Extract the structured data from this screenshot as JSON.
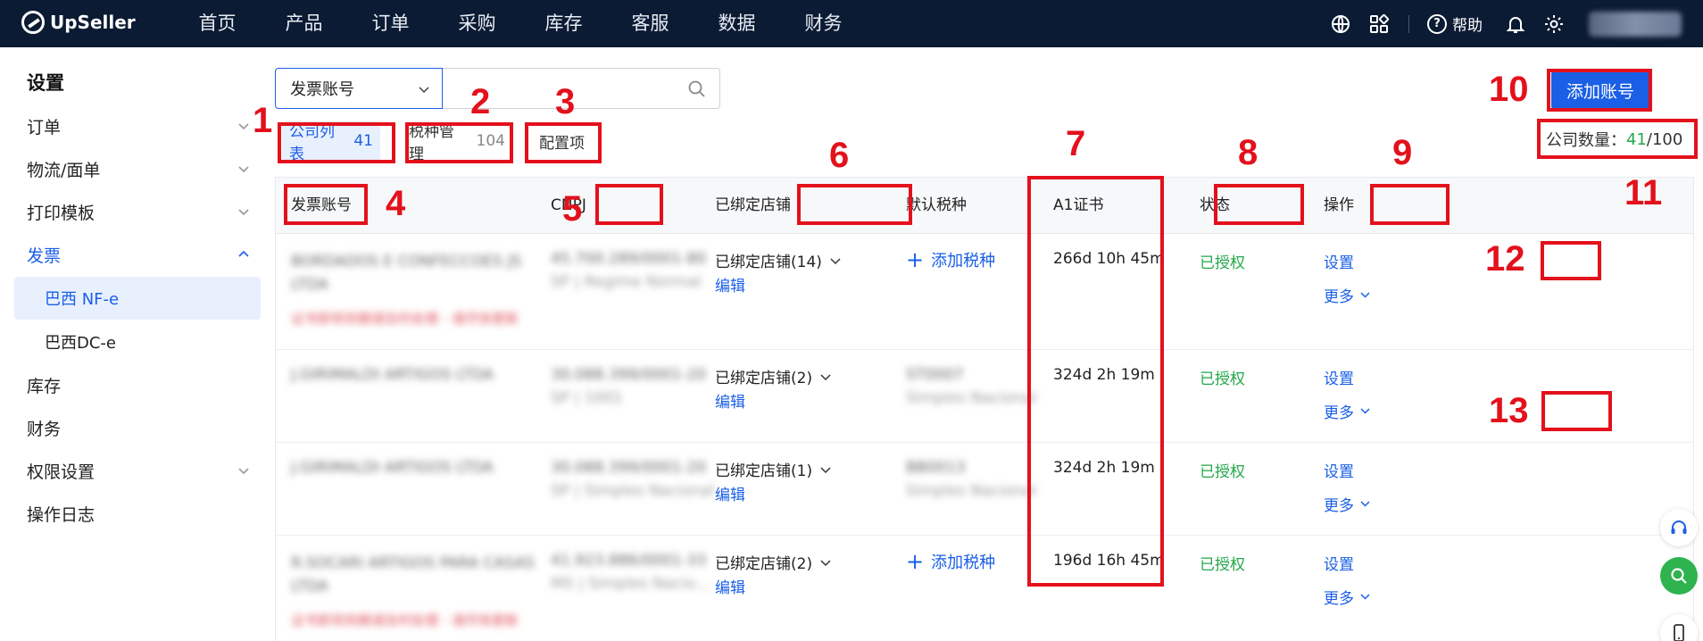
{
  "brand": "UpSeller",
  "nav": [
    "首页",
    "产品",
    "订单",
    "采购",
    "库存",
    "客服",
    "数据",
    "财务"
  ],
  "topbar": {
    "help_label": "帮助"
  },
  "sidebar": {
    "title": "设置",
    "items": [
      {
        "label": "订单"
      },
      {
        "label": "物流/面单"
      },
      {
        "label": "打印模板"
      },
      {
        "label": "发票"
      },
      {
        "label": "巴西 NF-e"
      },
      {
        "label": "巴西DC-e"
      },
      {
        "label": "库存"
      },
      {
        "label": "财务"
      },
      {
        "label": "权限设置"
      },
      {
        "label": "操作日志"
      }
    ]
  },
  "filter": {
    "select_value": "发票账号",
    "search_placeholder": ""
  },
  "tabs": [
    {
      "label": "公司列表",
      "count": "41"
    },
    {
      "label": "税种管理",
      "count": "104"
    },
    {
      "label": "配置项",
      "count": ""
    }
  ],
  "add_button": "添加账号",
  "company_count": {
    "label": "公司数量：",
    "value": "41",
    "total": "/100"
  },
  "table": {
    "headers": [
      "发票账号",
      "CNPJ",
      "已绑定店铺",
      "默认税种",
      "A1证书",
      "状态",
      "操作"
    ],
    "rows": [
      {
        "account": "BORDADOS E CONFECCOES JS LTDA",
        "account_note": "证书即将到期请及时处理 - 请尽快更新",
        "cnpj": "45.700.289/0001-80",
        "cnpj_sub": "SP | Regime Normal",
        "store": "已绑定店铺(14)",
        "edit": "编辑",
        "tax": "添加税种",
        "tax_sub": "",
        "cert": "266d 10h 45m",
        "status": "已授权",
        "op": "设置",
        "more": "更多"
      },
      {
        "account": "J.GIRIMALDI ARTIGOS LTDA",
        "account_note": "",
        "cnpj": "30.088.399/0001-20",
        "cnpj_sub": "SP | 1001",
        "store": "已绑定店铺(2)",
        "edit": "编辑",
        "tax": "ST0007",
        "tax_sub": "Simples Nacional",
        "cert": "324d 2h 19m",
        "status": "已授权",
        "op": "设置",
        "more": "更多"
      },
      {
        "account": "J.GIRIMALDI ARTIGOS LTDA",
        "account_note": "",
        "cnpj": "30.088.399/0001-20",
        "cnpj_sub": "SP | Simples Nacional",
        "store": "已绑定店铺(1)",
        "edit": "编辑",
        "tax": "BB0013",
        "tax_sub": "Simples Nacional",
        "cert": "324d 2h 19m",
        "status": "已授权",
        "op": "设置",
        "more": "更多"
      },
      {
        "account": "R.SOCARI ARTIGOS PARA CASAS LTDA",
        "account_note": "证书即将到期请及时处理 - 请尽快更新",
        "cnpj": "41.923.886/0001-33",
        "cnpj_sub": "MS | Simples Nacio...",
        "store": "已绑定店铺(2)",
        "edit": "编辑",
        "tax": "添加税种",
        "tax_sub": "",
        "cert": "196d 16h 45m",
        "status": "已授权",
        "op": "设置",
        "more": "更多"
      }
    ]
  },
  "annotations": [
    "1",
    "2",
    "3",
    "4",
    "5",
    "6",
    "7",
    "8",
    "9",
    "10",
    "11",
    "12",
    "13"
  ],
  "colors": {
    "accent": "#1a5fe6",
    "nav_bg": "#0b1b33",
    "success": "#23a84a",
    "annotation": "#e3111c"
  }
}
